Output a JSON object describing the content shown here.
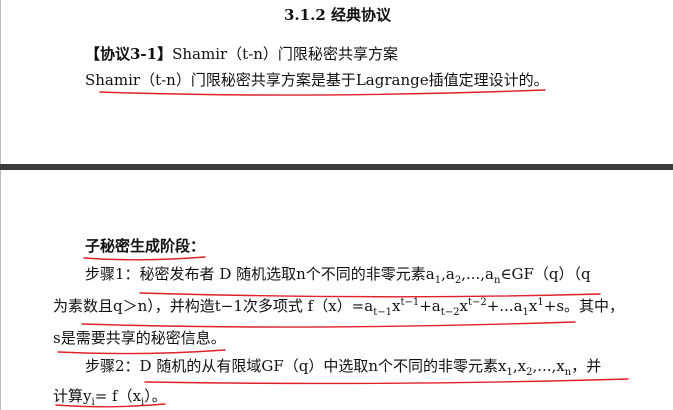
{
  "section_heading": "3.1.2 经典协议",
  "protocol": {
    "tag": "【协议3-1】",
    "name": "Shamir（t-n）门限秘密共享方案",
    "description": "Shamir（t-n）门限秘密共享方案是基于Lagrange插值定理设计的。"
  },
  "subkey_section": {
    "title": "子秘密生成阶段：",
    "step1": {
      "label": "步骤1：",
      "line1": "秘密发布者 D 随机选取n个不同的非零元素a1,a2,...,an∈GF（q）（q",
      "line2": "为素数且q＞n），并构造t−1次多项式 f（x）=at−1xt−1+at−2xt−2+...a1x1+s。其中，",
      "line3": "s是需要共享的秘密信息。"
    },
    "step2": {
      "label": "步骤2：",
      "line1": "D 随机的从有限域GF（q）中选取n个不同的非零元素x1,x2,...,xn，并",
      "line2": "计算yi= f（xi）。"
    }
  },
  "annotation_color": "#e0202a"
}
